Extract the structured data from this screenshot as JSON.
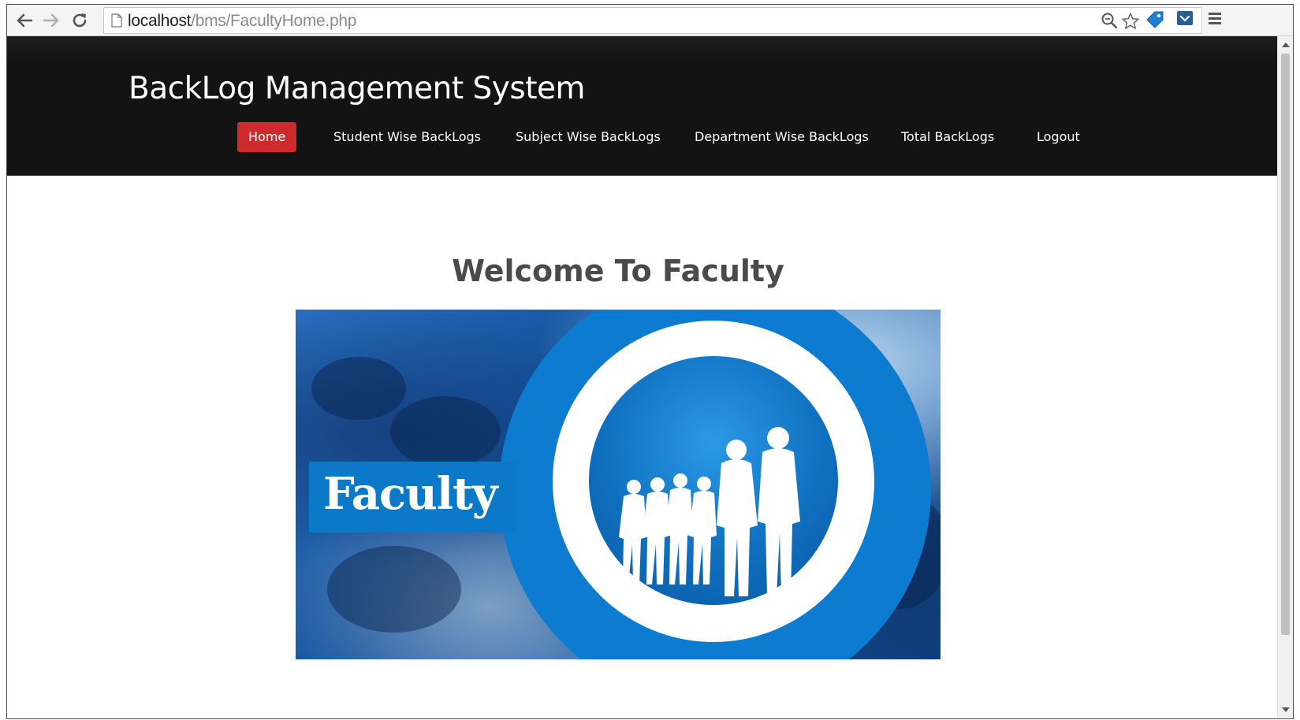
{
  "browser": {
    "url_host": "localhost",
    "url_path": "/bms/FacultyHome.php"
  },
  "site": {
    "title": "BackLog Management System",
    "nav": [
      {
        "label": "Home",
        "active": true
      },
      {
        "label": "Student Wise BackLogs",
        "active": false
      },
      {
        "label": "Subject Wise BackLogs",
        "active": false
      },
      {
        "label": "Department Wise BackLogs",
        "active": false
      },
      {
        "label": "Total BackLogs",
        "active": false
      },
      {
        "label": "Logout",
        "active": false
      }
    ]
  },
  "main": {
    "heading": "Welcome To Faculty",
    "banner_label": "Faculty"
  },
  "colors": {
    "header_bg": "#131313",
    "active_nav": "#cf2a2d",
    "banner_blue": "#0c7bd0"
  }
}
